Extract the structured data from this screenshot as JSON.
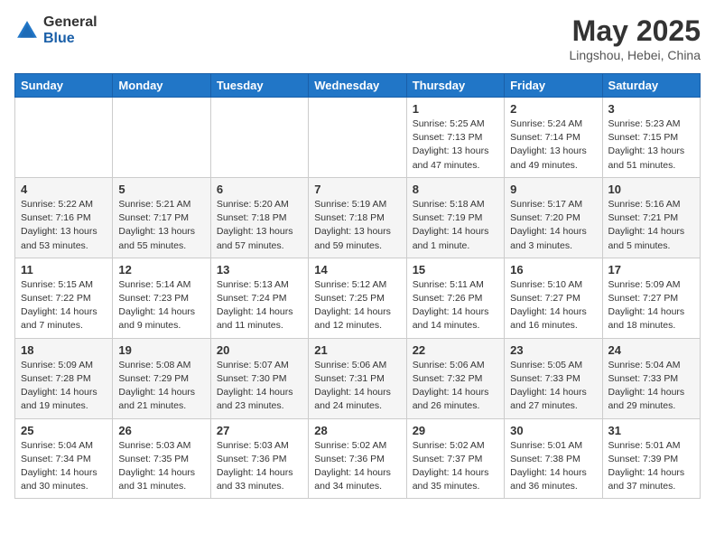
{
  "logo": {
    "general": "General",
    "blue": "Blue"
  },
  "title": "May 2025",
  "location": "Lingshou, Hebei, China",
  "days_header": [
    "Sunday",
    "Monday",
    "Tuesday",
    "Wednesday",
    "Thursday",
    "Friday",
    "Saturday"
  ],
  "weeks": [
    [
      {
        "day": "",
        "info": ""
      },
      {
        "day": "",
        "info": ""
      },
      {
        "day": "",
        "info": ""
      },
      {
        "day": "",
        "info": ""
      },
      {
        "day": "1",
        "info": "Sunrise: 5:25 AM\nSunset: 7:13 PM\nDaylight: 13 hours\nand 47 minutes."
      },
      {
        "day": "2",
        "info": "Sunrise: 5:24 AM\nSunset: 7:14 PM\nDaylight: 13 hours\nand 49 minutes."
      },
      {
        "day": "3",
        "info": "Sunrise: 5:23 AM\nSunset: 7:15 PM\nDaylight: 13 hours\nand 51 minutes."
      }
    ],
    [
      {
        "day": "4",
        "info": "Sunrise: 5:22 AM\nSunset: 7:16 PM\nDaylight: 13 hours\nand 53 minutes."
      },
      {
        "day": "5",
        "info": "Sunrise: 5:21 AM\nSunset: 7:17 PM\nDaylight: 13 hours\nand 55 minutes."
      },
      {
        "day": "6",
        "info": "Sunrise: 5:20 AM\nSunset: 7:18 PM\nDaylight: 13 hours\nand 57 minutes."
      },
      {
        "day": "7",
        "info": "Sunrise: 5:19 AM\nSunset: 7:18 PM\nDaylight: 13 hours\nand 59 minutes."
      },
      {
        "day": "8",
        "info": "Sunrise: 5:18 AM\nSunset: 7:19 PM\nDaylight: 14 hours\nand 1 minute."
      },
      {
        "day": "9",
        "info": "Sunrise: 5:17 AM\nSunset: 7:20 PM\nDaylight: 14 hours\nand 3 minutes."
      },
      {
        "day": "10",
        "info": "Sunrise: 5:16 AM\nSunset: 7:21 PM\nDaylight: 14 hours\nand 5 minutes."
      }
    ],
    [
      {
        "day": "11",
        "info": "Sunrise: 5:15 AM\nSunset: 7:22 PM\nDaylight: 14 hours\nand 7 minutes."
      },
      {
        "day": "12",
        "info": "Sunrise: 5:14 AM\nSunset: 7:23 PM\nDaylight: 14 hours\nand 9 minutes."
      },
      {
        "day": "13",
        "info": "Sunrise: 5:13 AM\nSunset: 7:24 PM\nDaylight: 14 hours\nand 11 minutes."
      },
      {
        "day": "14",
        "info": "Sunrise: 5:12 AM\nSunset: 7:25 PM\nDaylight: 14 hours\nand 12 minutes."
      },
      {
        "day": "15",
        "info": "Sunrise: 5:11 AM\nSunset: 7:26 PM\nDaylight: 14 hours\nand 14 minutes."
      },
      {
        "day": "16",
        "info": "Sunrise: 5:10 AM\nSunset: 7:27 PM\nDaylight: 14 hours\nand 16 minutes."
      },
      {
        "day": "17",
        "info": "Sunrise: 5:09 AM\nSunset: 7:27 PM\nDaylight: 14 hours\nand 18 minutes."
      }
    ],
    [
      {
        "day": "18",
        "info": "Sunrise: 5:09 AM\nSunset: 7:28 PM\nDaylight: 14 hours\nand 19 minutes."
      },
      {
        "day": "19",
        "info": "Sunrise: 5:08 AM\nSunset: 7:29 PM\nDaylight: 14 hours\nand 21 minutes."
      },
      {
        "day": "20",
        "info": "Sunrise: 5:07 AM\nSunset: 7:30 PM\nDaylight: 14 hours\nand 23 minutes."
      },
      {
        "day": "21",
        "info": "Sunrise: 5:06 AM\nSunset: 7:31 PM\nDaylight: 14 hours\nand 24 minutes."
      },
      {
        "day": "22",
        "info": "Sunrise: 5:06 AM\nSunset: 7:32 PM\nDaylight: 14 hours\nand 26 minutes."
      },
      {
        "day": "23",
        "info": "Sunrise: 5:05 AM\nSunset: 7:33 PM\nDaylight: 14 hours\nand 27 minutes."
      },
      {
        "day": "24",
        "info": "Sunrise: 5:04 AM\nSunset: 7:33 PM\nDaylight: 14 hours\nand 29 minutes."
      }
    ],
    [
      {
        "day": "25",
        "info": "Sunrise: 5:04 AM\nSunset: 7:34 PM\nDaylight: 14 hours\nand 30 minutes."
      },
      {
        "day": "26",
        "info": "Sunrise: 5:03 AM\nSunset: 7:35 PM\nDaylight: 14 hours\nand 31 minutes."
      },
      {
        "day": "27",
        "info": "Sunrise: 5:03 AM\nSunset: 7:36 PM\nDaylight: 14 hours\nand 33 minutes."
      },
      {
        "day": "28",
        "info": "Sunrise: 5:02 AM\nSunset: 7:36 PM\nDaylight: 14 hours\nand 34 minutes."
      },
      {
        "day": "29",
        "info": "Sunrise: 5:02 AM\nSunset: 7:37 PM\nDaylight: 14 hours\nand 35 minutes."
      },
      {
        "day": "30",
        "info": "Sunrise: 5:01 AM\nSunset: 7:38 PM\nDaylight: 14 hours\nand 36 minutes."
      },
      {
        "day": "31",
        "info": "Sunrise: 5:01 AM\nSunset: 7:39 PM\nDaylight: 14 hours\nand 37 minutes."
      }
    ]
  ]
}
